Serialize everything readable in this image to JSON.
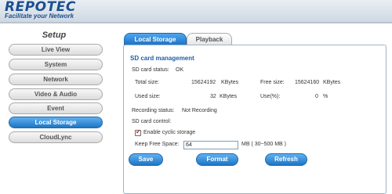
{
  "brand": {
    "name": "REPOTEC",
    "tagline": "Facilitate your Network"
  },
  "sidebar": {
    "title": "Setup",
    "items": [
      {
        "label": "Live View"
      },
      {
        "label": "System"
      },
      {
        "label": "Network"
      },
      {
        "label": "Video & Audio"
      },
      {
        "label": "Event"
      },
      {
        "label": "Local Storage"
      },
      {
        "label": "CloudLync"
      }
    ],
    "active": "Local Storage"
  },
  "tabs": [
    {
      "label": "Local Storage"
    },
    {
      "label": "Playback"
    }
  ],
  "panel": {
    "title": "SD card management",
    "sd_status_label": "SD card status:",
    "sd_status_value": "OK",
    "total_size_label": "Total size:",
    "total_size_value": "15624192",
    "total_size_unit": "KBytes",
    "free_size_label": "Free size:",
    "free_size_value": "15624160",
    "free_size_unit": "KBytes",
    "used_size_label": "Used size:",
    "used_size_value": "32",
    "used_size_unit": "KBytes",
    "use_pct_label": "Use(%):",
    "use_pct_value": "0",
    "use_pct_unit": "%",
    "recording_status_label": "Recording status:",
    "recording_status_value": "Not Recording",
    "sd_control_label": "SD card control:",
    "cyclic_label": "Enable cyclic storage",
    "cyclic_checked": true,
    "keep_free_label": "Keep Free Space:",
    "keep_free_value": "64",
    "keep_free_hint": "MB ( 30~500 MB )"
  },
  "buttons": {
    "save": "Save",
    "format": "Format",
    "refresh": "Refresh"
  },
  "colors": {
    "accent": "#1f76c4",
    "title": "#1f5fa8",
    "brand": "#1c4f8f"
  }
}
